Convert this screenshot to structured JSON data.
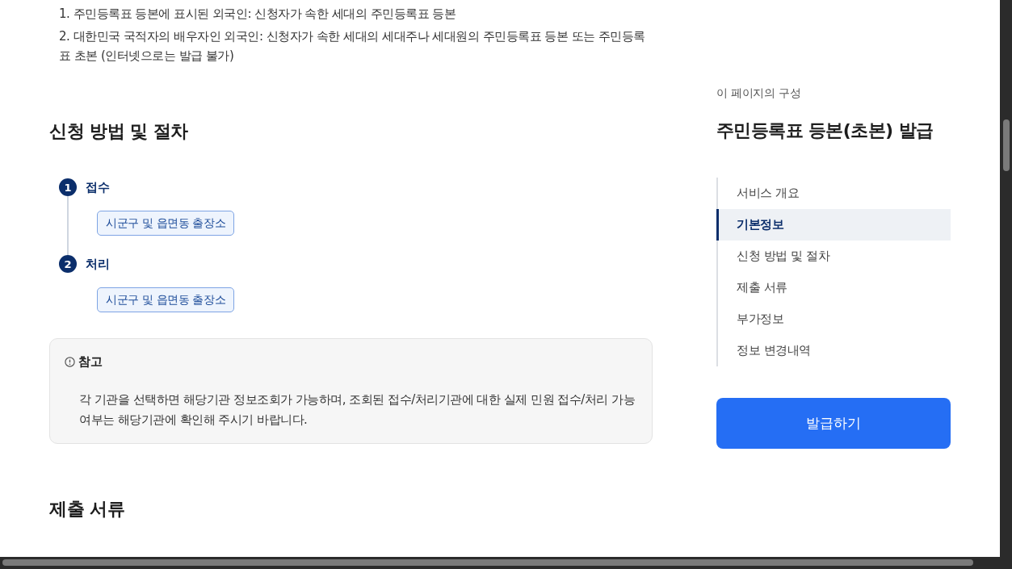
{
  "eligibility_list": [
    "1. 주민등록표 등본에 표시된 외국인: 신청자가 속한 세대의 주민등록표 등본",
    "2. 대한민국 국적자의 배우자인 외국인: 신청자가 속한 세대의 세대주나 세대원의 주민등록표 등본 또는 주민등록표 초본 (인터넷으로는 발급 불가)"
  ],
  "procedure": {
    "heading": "신청 방법 및 절차",
    "steps": [
      {
        "number": "1",
        "label": "접수",
        "offices": [
          "시군구 및 읍면동 출장소"
        ]
      },
      {
        "number": "2",
        "label": "처리",
        "offices": [
          "시군구 및 읍면동 출장소"
        ]
      }
    ]
  },
  "note": {
    "title": "참고",
    "text": "각 기관을 선택하면 해당기관 정보조회가 가능하며, 조회된 접수/처리기관에 대한 실제 민원 접수/처리 가능 여부는 해당기관에 확인해 주시기 바랍니다."
  },
  "documents": {
    "heading": "제출 서류"
  },
  "toc": {
    "caption": "이 페이지의 구성",
    "title": "주민등록표 등본(초본) 발급",
    "items": [
      {
        "label": "서비스 개요",
        "selected": false
      },
      {
        "label": "기본정보",
        "selected": true
      },
      {
        "label": "신청 방법 및 절차",
        "selected": false
      },
      {
        "label": "제출 서류",
        "selected": false
      },
      {
        "label": "부가정보",
        "selected": false
      },
      {
        "label": "정보 변경내역",
        "selected": false
      }
    ]
  },
  "issue_button": "발급하기"
}
